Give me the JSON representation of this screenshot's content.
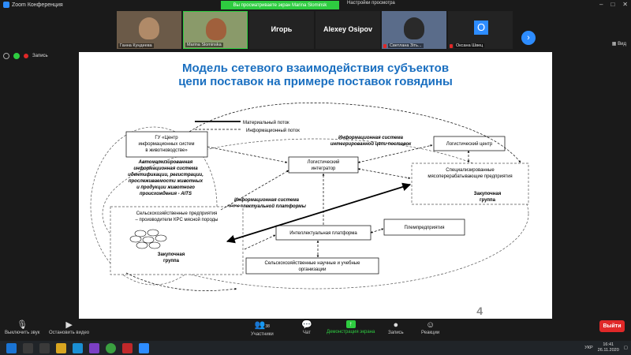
{
  "window": {
    "title": "Zoom Конференция"
  },
  "banner": {
    "sharing_text": "Вы просматриваете экран Marina Slominsk",
    "view_options": "Настройки просмотра",
    "view_button": "Вид"
  },
  "gallery": [
    {
      "name": "Ганна Кундеева",
      "kind": "video"
    },
    {
      "name": "Marina Slominska",
      "kind": "video"
    },
    {
      "name": "Игорь",
      "kind": "name"
    },
    {
      "name": "Alexey Osipov",
      "kind": "name"
    },
    {
      "name": "Светлана Зiть...",
      "kind": "video"
    },
    {
      "name": "Оксана Швец",
      "kind": "initial",
      "initial": "О"
    }
  ],
  "status": {
    "record_label": "Запись"
  },
  "slide": {
    "title_line1": "Модель сетевого взаимодействия субъектов",
    "title_line2": "цепи поставок на примере поставок говядины",
    "page_number": "4",
    "legend_material": "Материальный поток",
    "legend_info": "Информационный поток",
    "gu_box_1": "ГУ «Центр",
    "gu_box_2": "информационных систем",
    "gu_box_3": "в животноводстве»",
    "auto_1": "Автоматизированная",
    "auto_2": "информационная система",
    "auto_3": "идентификации, регистрации,",
    "auto_4": "прослеживаемости животных",
    "auto_5": "и продукции животного",
    "auto_6": "происхождения - AITS",
    "log_int_1": "Логистический",
    "log_int_2": "интегратор",
    "is_chain_1": "Информационная система",
    "is_chain_2": "интегрированной цепи поставок",
    "log_center": "Логистический центр",
    "meat_1": "Специализированные",
    "meat_2": "мясоперерабатывающие предприятия",
    "buy_group_right_1": "Закупочная",
    "buy_group_right_2": "группа",
    "is_platform_1": "Информационная система",
    "is_platform_2": "интеллектуальной платформы",
    "farm_1": "Сельскохозяйственные предприятия",
    "farm_2": "– производители КРС мясной породы",
    "buy_group_left_1": "Закупочная",
    "buy_group_left_2": "группа",
    "intel_platform": "Интеллектуальная платформа",
    "breeding": "Племпредприятия",
    "sci_1": "Сельскохозяйственные научные и учебные",
    "sci_2": "организации"
  },
  "toolbar": {
    "mute": "Выключить звук",
    "video": "Остановить видео",
    "participants": "Участники",
    "participants_count": "38",
    "chat": "Чат",
    "share": "Демонстрация экрана",
    "record": "Запись",
    "reactions": "Реакции",
    "leave": "Выйти"
  },
  "taskbar": {
    "time": "16:41",
    "date": "26.11.2020",
    "lang": "УКР"
  },
  "colors": {
    "zoom_blue": "#2d8cff",
    "share_green": "#2ecc40",
    "leave_red": "#e02828",
    "slide_title": "#1a6fc0"
  }
}
